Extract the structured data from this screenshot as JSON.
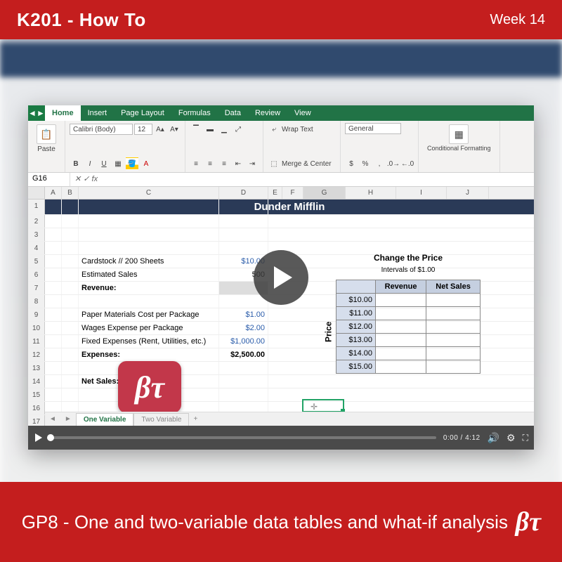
{
  "header": {
    "title": "K201 - How To",
    "week": "Week 14"
  },
  "footer": {
    "title": "GP8 - One and two-variable data tables and what-if analysis",
    "logo": "βτ"
  },
  "ribbon": {
    "tabs": [
      "Home",
      "Insert",
      "Page Layout",
      "Formulas",
      "Data",
      "Review",
      "View"
    ],
    "active_tab": 0,
    "paste_label": "Paste",
    "font_name": "Calibri (Body)",
    "font_size": "12",
    "wrap_text": "Wrap Text",
    "merge_center": "Merge & Center",
    "number_format": "General",
    "conditional_label": "Conditional Formatting"
  },
  "formula_bar": {
    "cell_ref": "G16",
    "fx": "fx",
    "formula": ""
  },
  "columns": [
    "A",
    "B",
    "C",
    "D",
    "E",
    "F",
    "G",
    "H",
    "I",
    "J"
  ],
  "sheet": {
    "title_band": "Dunder Mifflin",
    "data": {
      "cardstock_label": "Cardstock // 200 Sheets",
      "cardstock_price": "$10.00",
      "est_sales_label": "Estimated Sales",
      "est_sales_value": "500",
      "revenue_label": "Revenue:",
      "paper_mat_label": "Paper Materials Cost per Package",
      "paper_mat_value": "$1.00",
      "wages_label": "Wages Expense per Package",
      "wages_value": "$2.00",
      "fixed_label": "Fixed Expenses (Rent, Utilities, etc.)",
      "fixed_value": "$1,000.00",
      "expenses_label": "Expenses:",
      "expenses_value": "$2,500.00",
      "net_sales_label": "Net Sales:"
    },
    "right": {
      "heading": "Change the Price",
      "subheading": "Intervals of $1.00",
      "price_rot": "Price",
      "col1": "Revenue",
      "col2": "Net Sales",
      "prices": [
        "$10.00",
        "$11.00",
        "$12.00",
        "$13.00",
        "$14.00",
        "$15.00"
      ]
    },
    "sheet_tabs": {
      "active": "One Variable",
      "inactive": "Two Variable",
      "plus": "+"
    }
  },
  "video": {
    "current_time": "0:00",
    "duration": "4:12"
  },
  "stamp": "βτ"
}
